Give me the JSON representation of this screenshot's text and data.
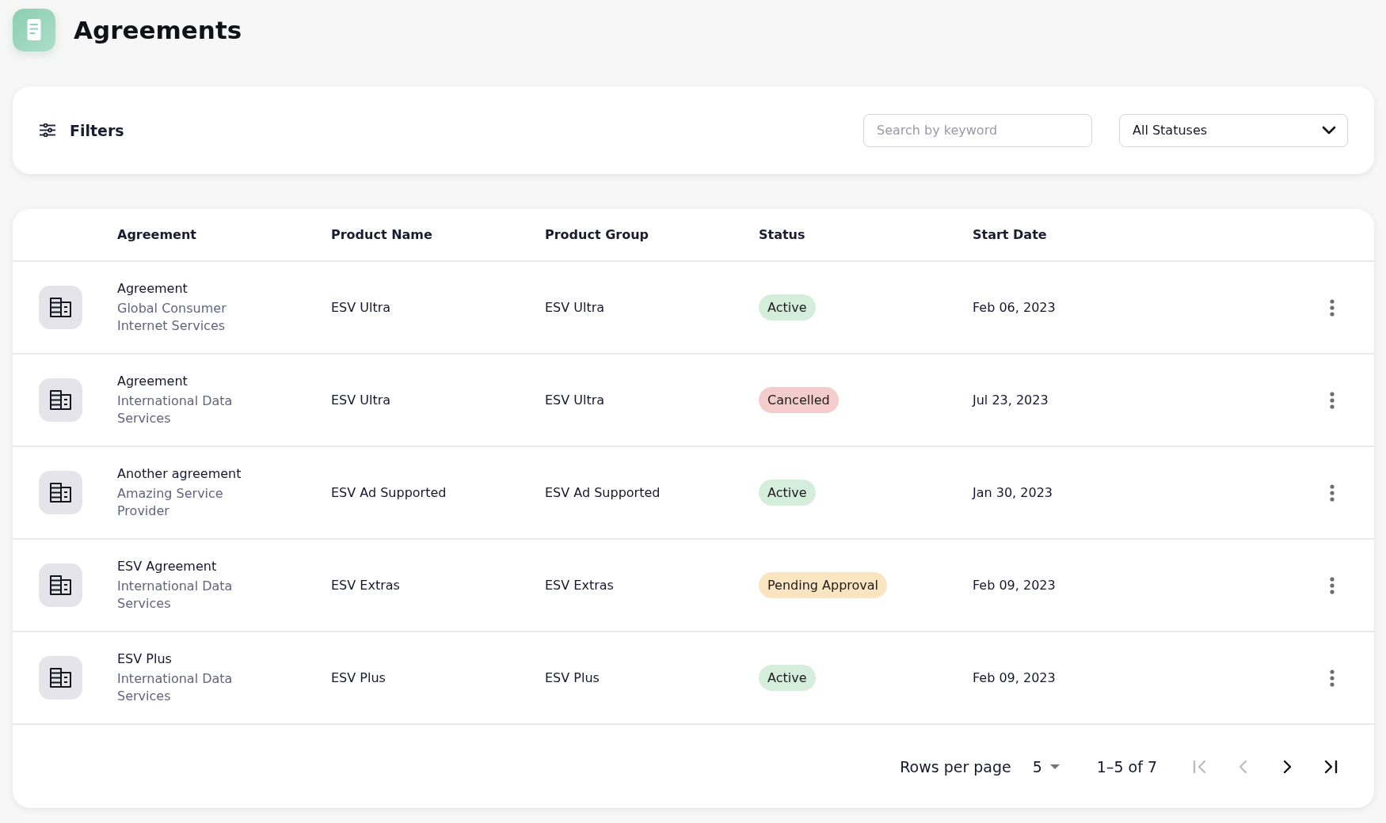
{
  "header": {
    "title": "Agreements"
  },
  "filters": {
    "label": "Filters",
    "search": {
      "placeholder": "Search by keyword"
    },
    "status_select": {
      "value": "All Statuses"
    }
  },
  "table": {
    "columns": [
      "Agreement",
      "Product Name",
      "Product Group",
      "Status",
      "Start Date"
    ],
    "rows": [
      {
        "agreement": "Agreement",
        "company": "Global Consumer Internet Services",
        "product_name": "ESV Ultra",
        "product_group": "ESV Ultra",
        "status": {
          "label": "Active",
          "color": "#d5eddb"
        },
        "start_date": "Feb 06, 2023"
      },
      {
        "agreement": "Agreement",
        "company": "International Data Services",
        "product_name": "ESV Ultra",
        "product_group": "ESV Ultra",
        "status": {
          "label": "Cancelled",
          "color": "#f4cccc"
        },
        "start_date": "Jul 23, 2023"
      },
      {
        "agreement": "Another agreement",
        "company": "Amazing Service Provider",
        "product_name": "ESV Ad Supported",
        "product_group": "ESV Ad Supported",
        "status": {
          "label": "Active",
          "color": "#d5eddb"
        },
        "start_date": "Jan 30, 2023"
      },
      {
        "agreement": "ESV Agreement",
        "company": "International Data Services",
        "product_name": "ESV Extras",
        "product_group": "ESV Extras",
        "status": {
          "label": "Pending Approval",
          "color": "#fbe5c0"
        },
        "start_date": "Feb 09, 2023"
      },
      {
        "agreement": "ESV Plus",
        "company": "International Data Services",
        "product_name": "ESV Plus",
        "product_group": "ESV Plus",
        "status": {
          "label": "Active",
          "color": "#d5eddb"
        },
        "start_date": "Feb 09, 2023"
      }
    ]
  },
  "pagination": {
    "rows_per_page_label": "Rows per page",
    "rows_per_page": "5",
    "range": "1–5 of 7",
    "buttons": [
      {
        "kind": "first",
        "disabled": true
      },
      {
        "kind": "previous",
        "disabled": true
      },
      {
        "kind": "next",
        "disabled": false
      },
      {
        "kind": "last",
        "disabled": false
      }
    ]
  }
}
